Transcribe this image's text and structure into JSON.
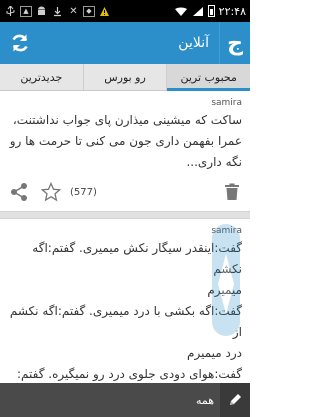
{
  "status_bar": {
    "time": "۲۲:۴۸",
    "notification_icons": [
      "usb-icon",
      "image-icon",
      "android-icon",
      "download-icon",
      "tools-icon",
      "bag-icon",
      "warning-icon"
    ]
  },
  "action_bar": {
    "title": "آنلاین",
    "logo_glyph": "ج",
    "background": "#2d8fc9"
  },
  "tabs": [
    {
      "label": "جدیدترین",
      "active": false
    },
    {
      "label": "رو بورس",
      "active": false
    },
    {
      "label": "محبوب ترین",
      "active": true
    }
  ],
  "posts": [
    {
      "user": "samira",
      "lines": [
        "ساکت که میشینی میذارن پای جواب نداشتنت،",
        "عمرا بفهمن داری جون می کنی تا حرمت ها رو",
        "نگه داری..."
      ],
      "likes": "(577)"
    },
    {
      "user": "samira",
      "lines": [
        "گفت:اینقدر سیگار نکش میمیری. گفتم:اگه نکشم",
        "میمیرم",
        "گفت:اگه بکشی با درد میمیری. گفتم:اگه نکشم از",
        "درد میمیرم",
        "گفت:هوای دودی جلوی درد رو نمیگیره. گفتم:"
      ]
    }
  ],
  "bottom_bar": {
    "label": "همه"
  }
}
